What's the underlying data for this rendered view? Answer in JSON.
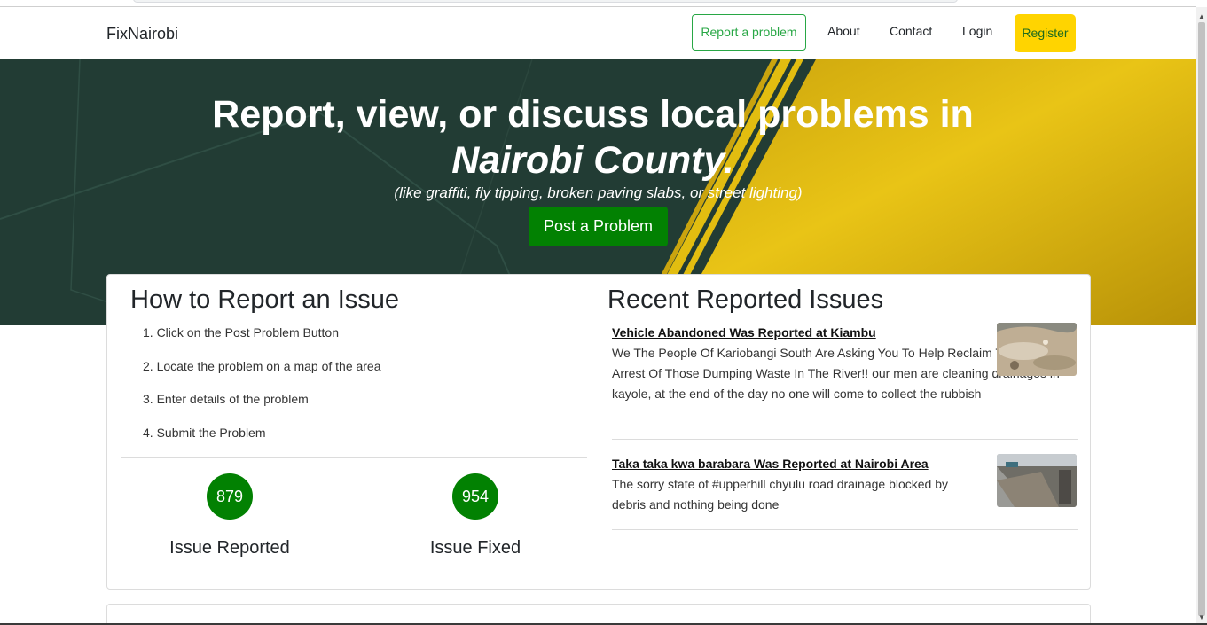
{
  "nav": {
    "brand": "FixNairobi",
    "report": "Report a problem",
    "about": "About",
    "contact": "Contact",
    "login": "Login",
    "register": "Register"
  },
  "hero": {
    "title_line1": "Report, view, or discuss local problems in",
    "title_line2": "Nairobi County.",
    "subtitle": "(like graffiti, fly tipping, broken paving slabs, or street lighting)",
    "button": "Post a Problem"
  },
  "how": {
    "title": "How to Report an Issue",
    "steps": [
      "1. Click on the Post Problem Button",
      "2. Locate the problem on a map of the area",
      "3. Enter details of the problem",
      "4. Submit the Problem"
    ]
  },
  "stats": [
    {
      "value": "879",
      "label": "Issue Reported"
    },
    {
      "value": "954",
      "label": "Issue Fixed"
    }
  ],
  "recent": {
    "title": "Recent Reported Issues",
    "items": [
      {
        "title": "Vehicle Abandoned Was Reported at Kiambu",
        "description": "We The People Of Kariobangi South Are Asking You To Help Reclaim This River And Arrest Of Those Dumping Waste In The River!! our men are cleaning drainages in kayole, at the end of the day no one will come to collect the rubbish"
      },
      {
        "title": "Taka taka kwa barabara Was Reported at Nairobi Area",
        "description": "The sorry state of #upperhill chyulu road drainage blocked by debris and nothing being done"
      }
    ]
  },
  "colors": {
    "hero_dark": "#223c34",
    "hero_gold": "#e2bd10",
    "accent_green": "#028102",
    "register_yellow": "#ffd400",
    "outline_green": "#28a745"
  }
}
